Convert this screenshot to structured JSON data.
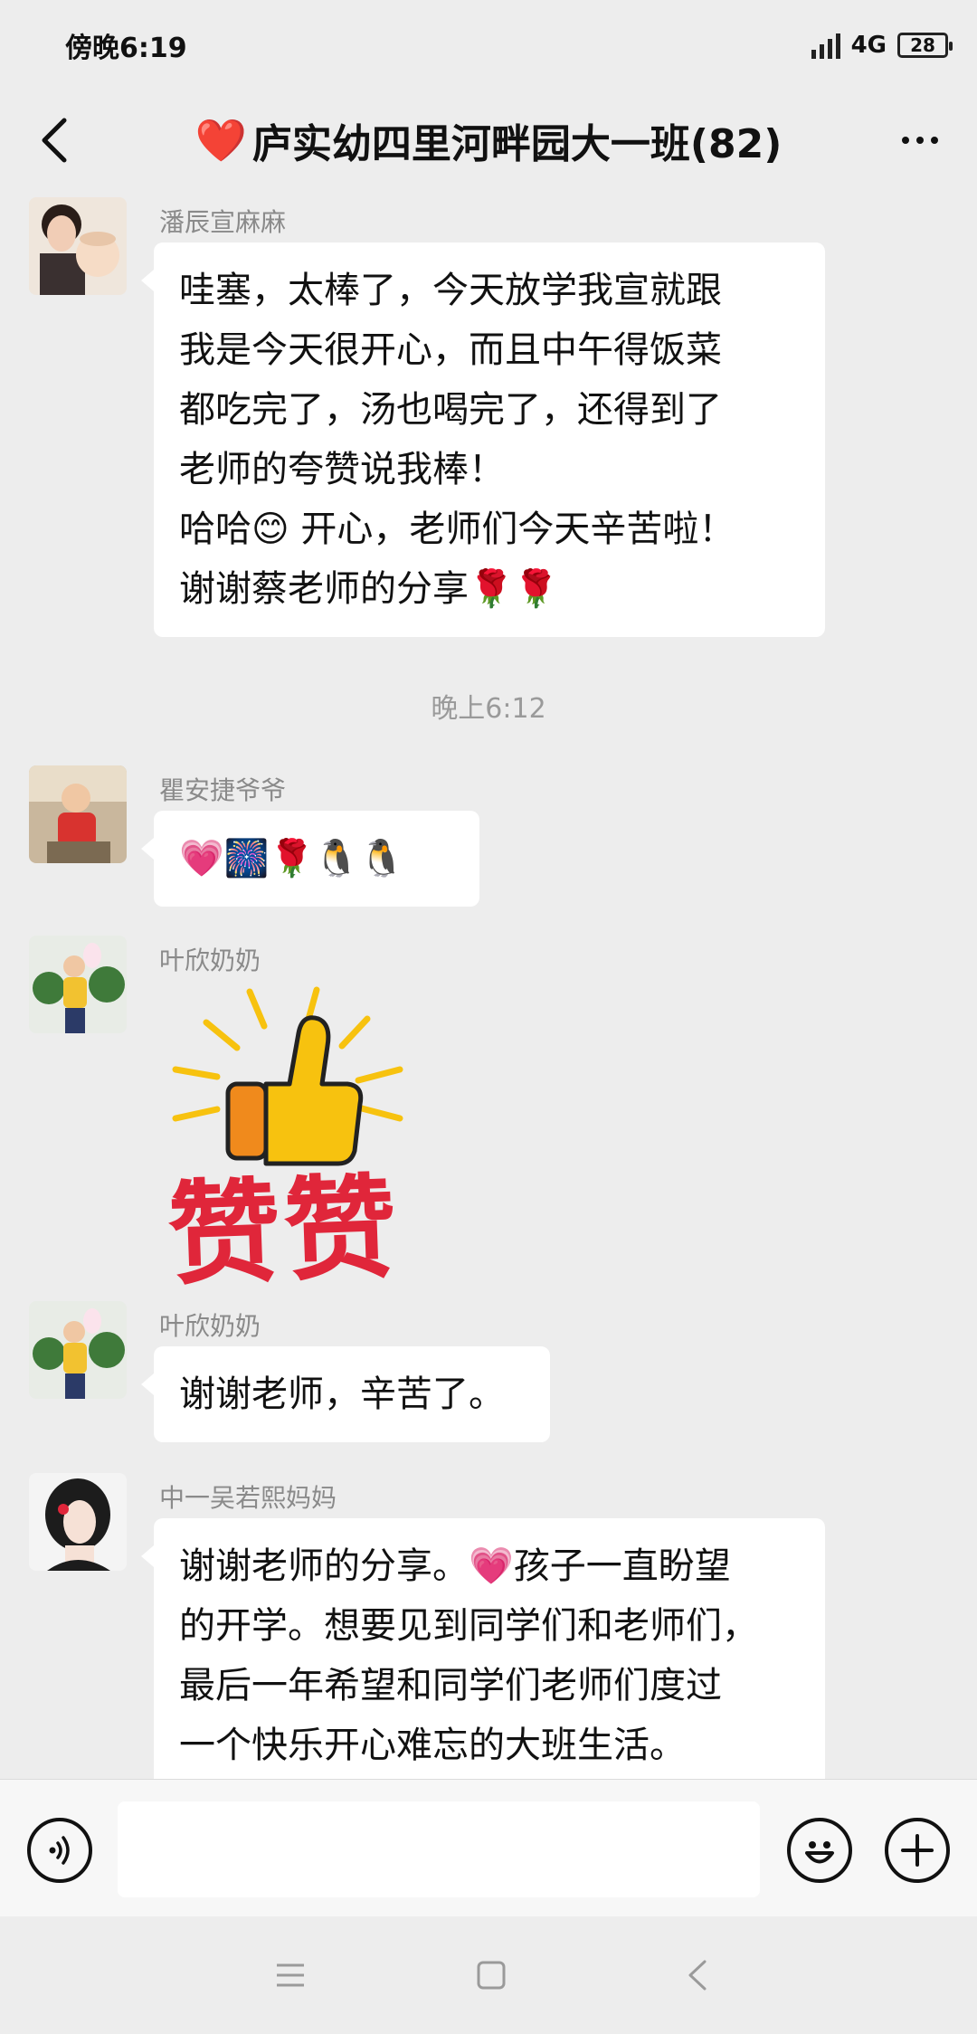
{
  "status_bar": {
    "time": "傍晚6:19",
    "network": "4G",
    "battery": "28"
  },
  "header": {
    "title": "庐实幼四里河畔园大一班(82)",
    "title_heart": "❤️"
  },
  "messages": [
    {
      "sender": "潘辰宣麻麻",
      "lines": [
        "哇塞，太棒了，今天放学我宣就跟",
        "我是今天很开心，而且中午得饭菜",
        "都吃完了，汤也喝完了，还得到了",
        "老师的夸赞说我棒！",
        "哈哈😊 开心，老师们今天辛苦啦！",
        "谢谢蔡老师的分享🌹🌹"
      ]
    },
    {
      "sender": "瞿安捷爷爷",
      "lines": [
        "💗🎆🌹🐧🐧"
      ]
    },
    {
      "sender": "叶欣奶奶",
      "sticker_text": "赞赞"
    },
    {
      "sender": "叶欣奶奶",
      "lines": [
        "谢谢老师，辛苦了。"
      ]
    },
    {
      "sender": "中一吴若熙妈妈",
      "lines": [
        "谢谢老师的分享。💗孩子一直盼望",
        "的开学。想要见到同学们和老师们，",
        "最后一年希望和同学们老师们度过",
        "一个快乐开心难忘的大班生活。"
      ]
    }
  ],
  "timestamp": "晚上6:12",
  "input": {
    "placeholder": ""
  },
  "colors": {
    "background": "#ededed",
    "bubble": "#ffffff",
    "sender_gray": "#8a8a8a",
    "sticker_red": "#e0263a",
    "thumb_yellow": "#f7c20f",
    "thumb_orange": "#f08a1c"
  }
}
